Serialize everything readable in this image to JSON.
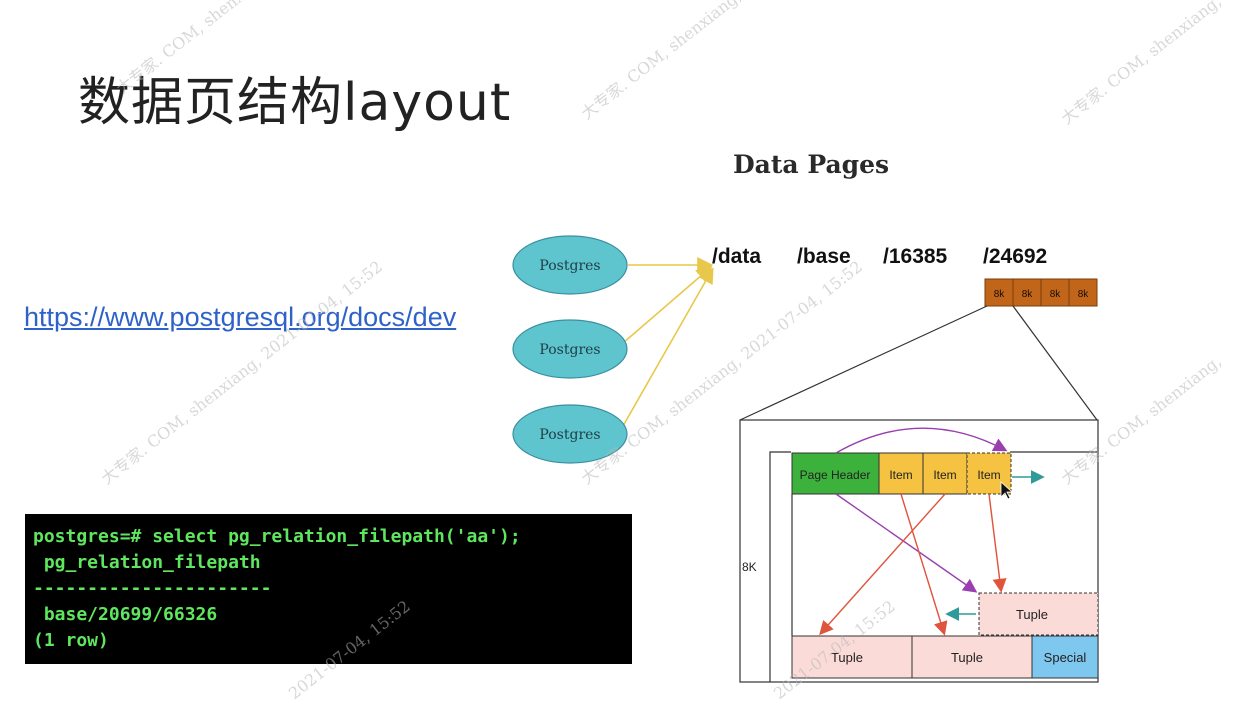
{
  "slide": {
    "title": "数据页结构layout",
    "link_text": "https://www.postgresql.org/docs/dev"
  },
  "terminal": {
    "lines": [
      "postgres=# select pg_relation_filepath('aa');",
      " pg_relation_filepath",
      "----------------------",
      " base/20699/66326",
      "(1 row)"
    ]
  },
  "diagram": {
    "title": "Data Pages",
    "processes": [
      "Postgres",
      "Postgres",
      "Postgres"
    ],
    "path_segments": [
      "/data",
      "/base",
      "/16385",
      "/24692"
    ],
    "blocks": [
      "8k",
      "8k",
      "8k",
      "8k"
    ],
    "page": {
      "size_label": "8K",
      "header": "Page Header",
      "items": [
        "Item",
        "Item",
        "Item"
      ],
      "tuples": [
        "Tuple",
        "Tuple",
        "Tuple"
      ],
      "special": "Special"
    },
    "colors": {
      "process_fill": "#5ec5cf",
      "block_fill": "#c0651a",
      "header_fill": "#3cb13c",
      "item_fill": "#f5c242",
      "tuple_fill": "#fadbd8",
      "special_fill": "#7ec8ef",
      "arrow_purple": "#9a3fb0",
      "arrow_red": "#e0533c",
      "arrow_teal": "#2f9a9a",
      "fan_line": "#e8c84a"
    }
  },
  "watermark": {
    "texts": [
      "大专家. COM, shenxiang,",
      "大专家. COM, shenxiang, 2021-07-04, 15:52",
      "2021-07-04, 15:52"
    ]
  }
}
